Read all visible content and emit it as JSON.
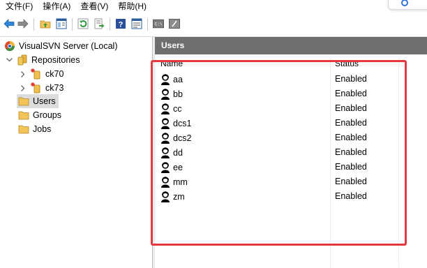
{
  "menubar": {
    "items": [
      {
        "label": "文件(F)"
      },
      {
        "label": "操作(A)"
      },
      {
        "label": "查看(V)"
      },
      {
        "label": "帮助(H)"
      }
    ]
  },
  "toolbar": {
    "icons": [
      "back-arrow-icon",
      "forward-arrow-icon",
      "up-folder-icon",
      "show-hide-tree-icon",
      "refresh-icon",
      "export-list-icon",
      "help-icon",
      "properties-icon",
      "console-icon",
      "command-icon"
    ]
  },
  "tree": {
    "root": {
      "label": "VisualSVN Server (Local)"
    },
    "repositories": {
      "label": "Repositories",
      "children": [
        {
          "label": "ck70"
        },
        {
          "label": "ck73"
        }
      ]
    },
    "users": {
      "label": "Users"
    },
    "groups": {
      "label": "Groups"
    },
    "jobs": {
      "label": "Jobs"
    }
  },
  "details": {
    "header": "Users",
    "columns": {
      "name": "Name",
      "status": "Status"
    },
    "rows": [
      {
        "name": "aa",
        "status": "Enabled"
      },
      {
        "name": "bb",
        "status": "Enabled"
      },
      {
        "name": "cc",
        "status": "Enabled"
      },
      {
        "name": "dcs1",
        "status": "Enabled"
      },
      {
        "name": "dcs2",
        "status": "Enabled"
      },
      {
        "name": "dd",
        "status": "Enabled"
      },
      {
        "name": "ee",
        "status": "Enabled"
      },
      {
        "name": "mm",
        "status": "Enabled"
      },
      {
        "name": "zm",
        "status": "Enabled"
      }
    ]
  },
  "colors": {
    "header_bg": "#6e6e6e",
    "highlight": "#e5393f",
    "selected": "#dcdcdc",
    "folder": "#f2c45a"
  }
}
